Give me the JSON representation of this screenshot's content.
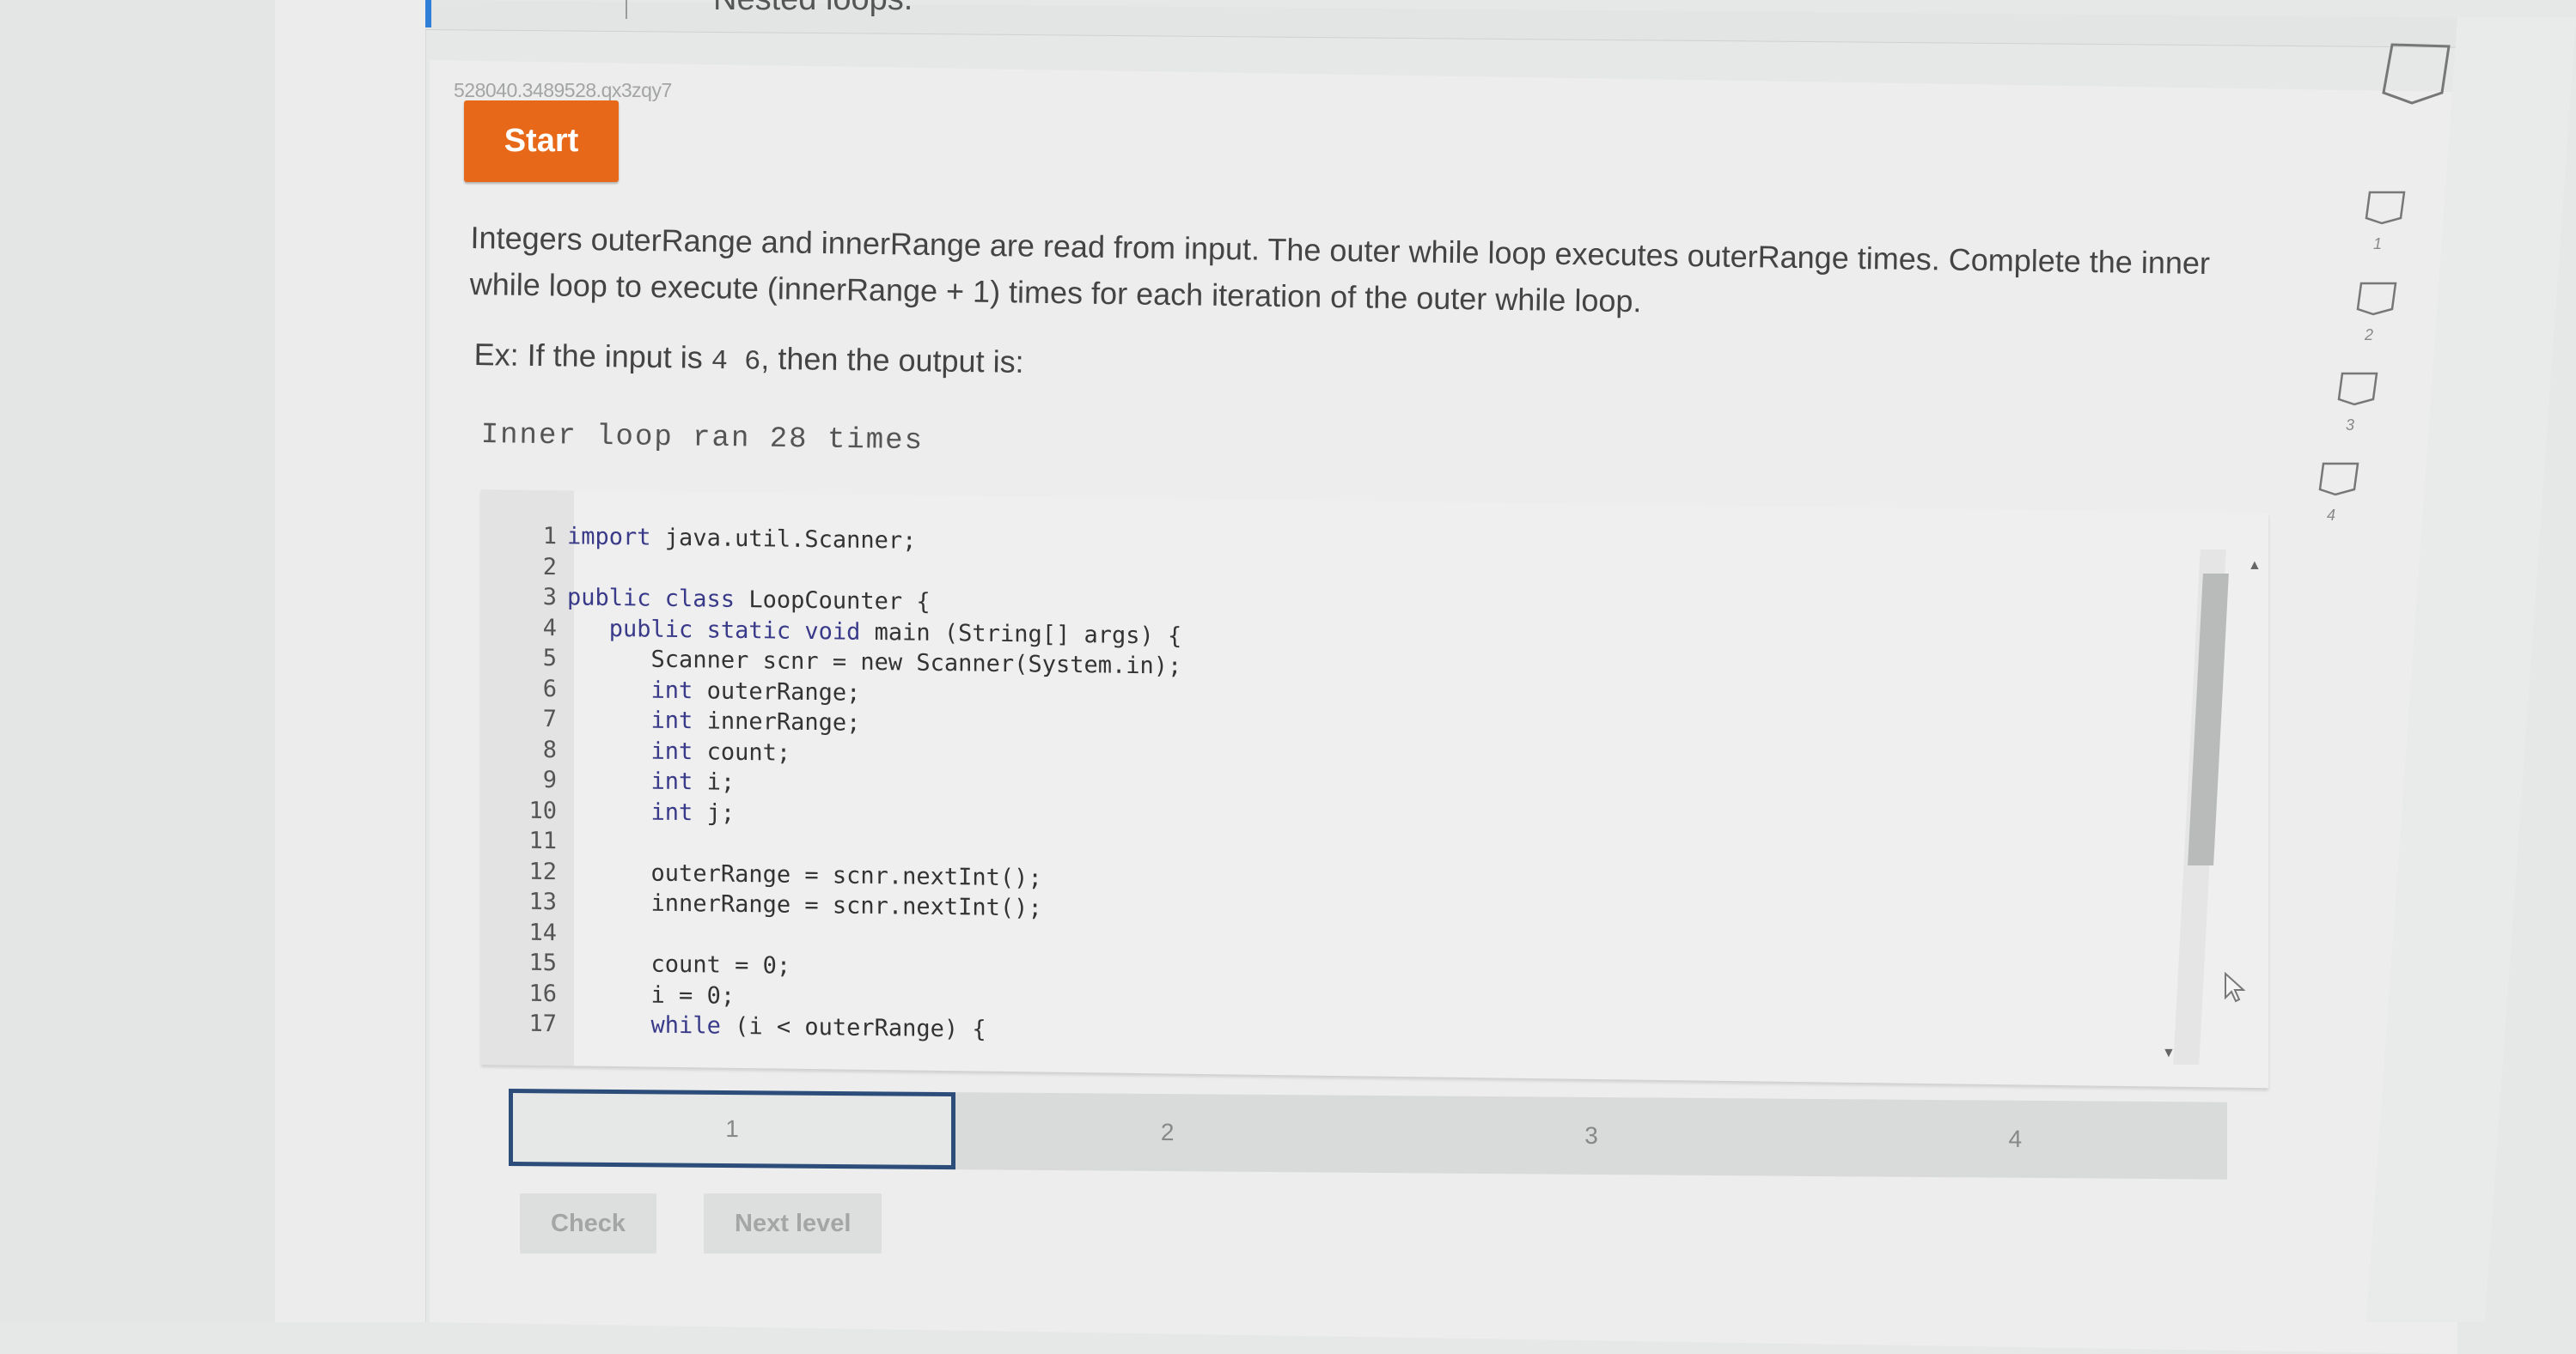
{
  "header": {
    "title_fragment": "Nested loops."
  },
  "activity": {
    "id": "528040.3489528.qx3zqy7",
    "start_label": "Start"
  },
  "prompt": {
    "line1": "Integers outerRange and innerRange are read from input. The outer while loop executes outerRange times. Complete the inner",
    "line2": "while loop to execute (innerRange + 1) times for each iteration of the outer while loop.",
    "example_prefix": "Ex: If the input is ",
    "example_input": "4  6",
    "example_suffix": ", then the output is:",
    "expected_output": "Inner loop ran 28 times"
  },
  "editor": {
    "lines": [
      {
        "n": "1",
        "indent": "",
        "kw": "import",
        "rest": " java.util.Scanner;"
      },
      {
        "n": "2",
        "indent": "",
        "kw": "",
        "rest": ""
      },
      {
        "n": "3",
        "indent": "",
        "kw": "public class",
        "rest": " LoopCounter {"
      },
      {
        "n": "4",
        "indent": "   ",
        "kw": "public static void",
        "rest": " main (String[] args) {"
      },
      {
        "n": "5",
        "indent": "      ",
        "kw": "",
        "rest": "Scanner scnr = new Scanner(System.in);"
      },
      {
        "n": "6",
        "indent": "      ",
        "kw": "int",
        "rest": " outerRange;"
      },
      {
        "n": "7",
        "indent": "      ",
        "kw": "int",
        "rest": " innerRange;"
      },
      {
        "n": "8",
        "indent": "      ",
        "kw": "int",
        "rest": " count;"
      },
      {
        "n": "9",
        "indent": "      ",
        "kw": "int",
        "rest": " i;"
      },
      {
        "n": "10",
        "indent": "      ",
        "kw": "int",
        "rest": " j;"
      },
      {
        "n": "11",
        "indent": "",
        "kw": "",
        "rest": ""
      },
      {
        "n": "12",
        "indent": "      ",
        "kw": "",
        "rest": "outerRange = scnr.nextInt();"
      },
      {
        "n": "13",
        "indent": "      ",
        "kw": "",
        "rest": "innerRange = scnr.nextInt();"
      },
      {
        "n": "14",
        "indent": "",
        "kw": "",
        "rest": ""
      },
      {
        "n": "15",
        "indent": "      ",
        "kw": "",
        "rest": "count = 0;"
      },
      {
        "n": "16",
        "indent": "      ",
        "kw": "",
        "rest": "i = 0;"
      },
      {
        "n": "17",
        "indent": "      ",
        "kw": "while",
        "rest": " (i < outerRange) {"
      }
    ]
  },
  "steps": [
    "1",
    "2",
    "3",
    "4"
  ],
  "active_step": "1",
  "actions": {
    "check_label": "Check",
    "next_label": "Next level"
  },
  "progress": {
    "badges": [
      "1",
      "2",
      "3",
      "4"
    ]
  },
  "colors": {
    "start_button": "#e8681a",
    "active_step_border": "#2c4c7a",
    "header_accent": "#2f7ed8"
  }
}
